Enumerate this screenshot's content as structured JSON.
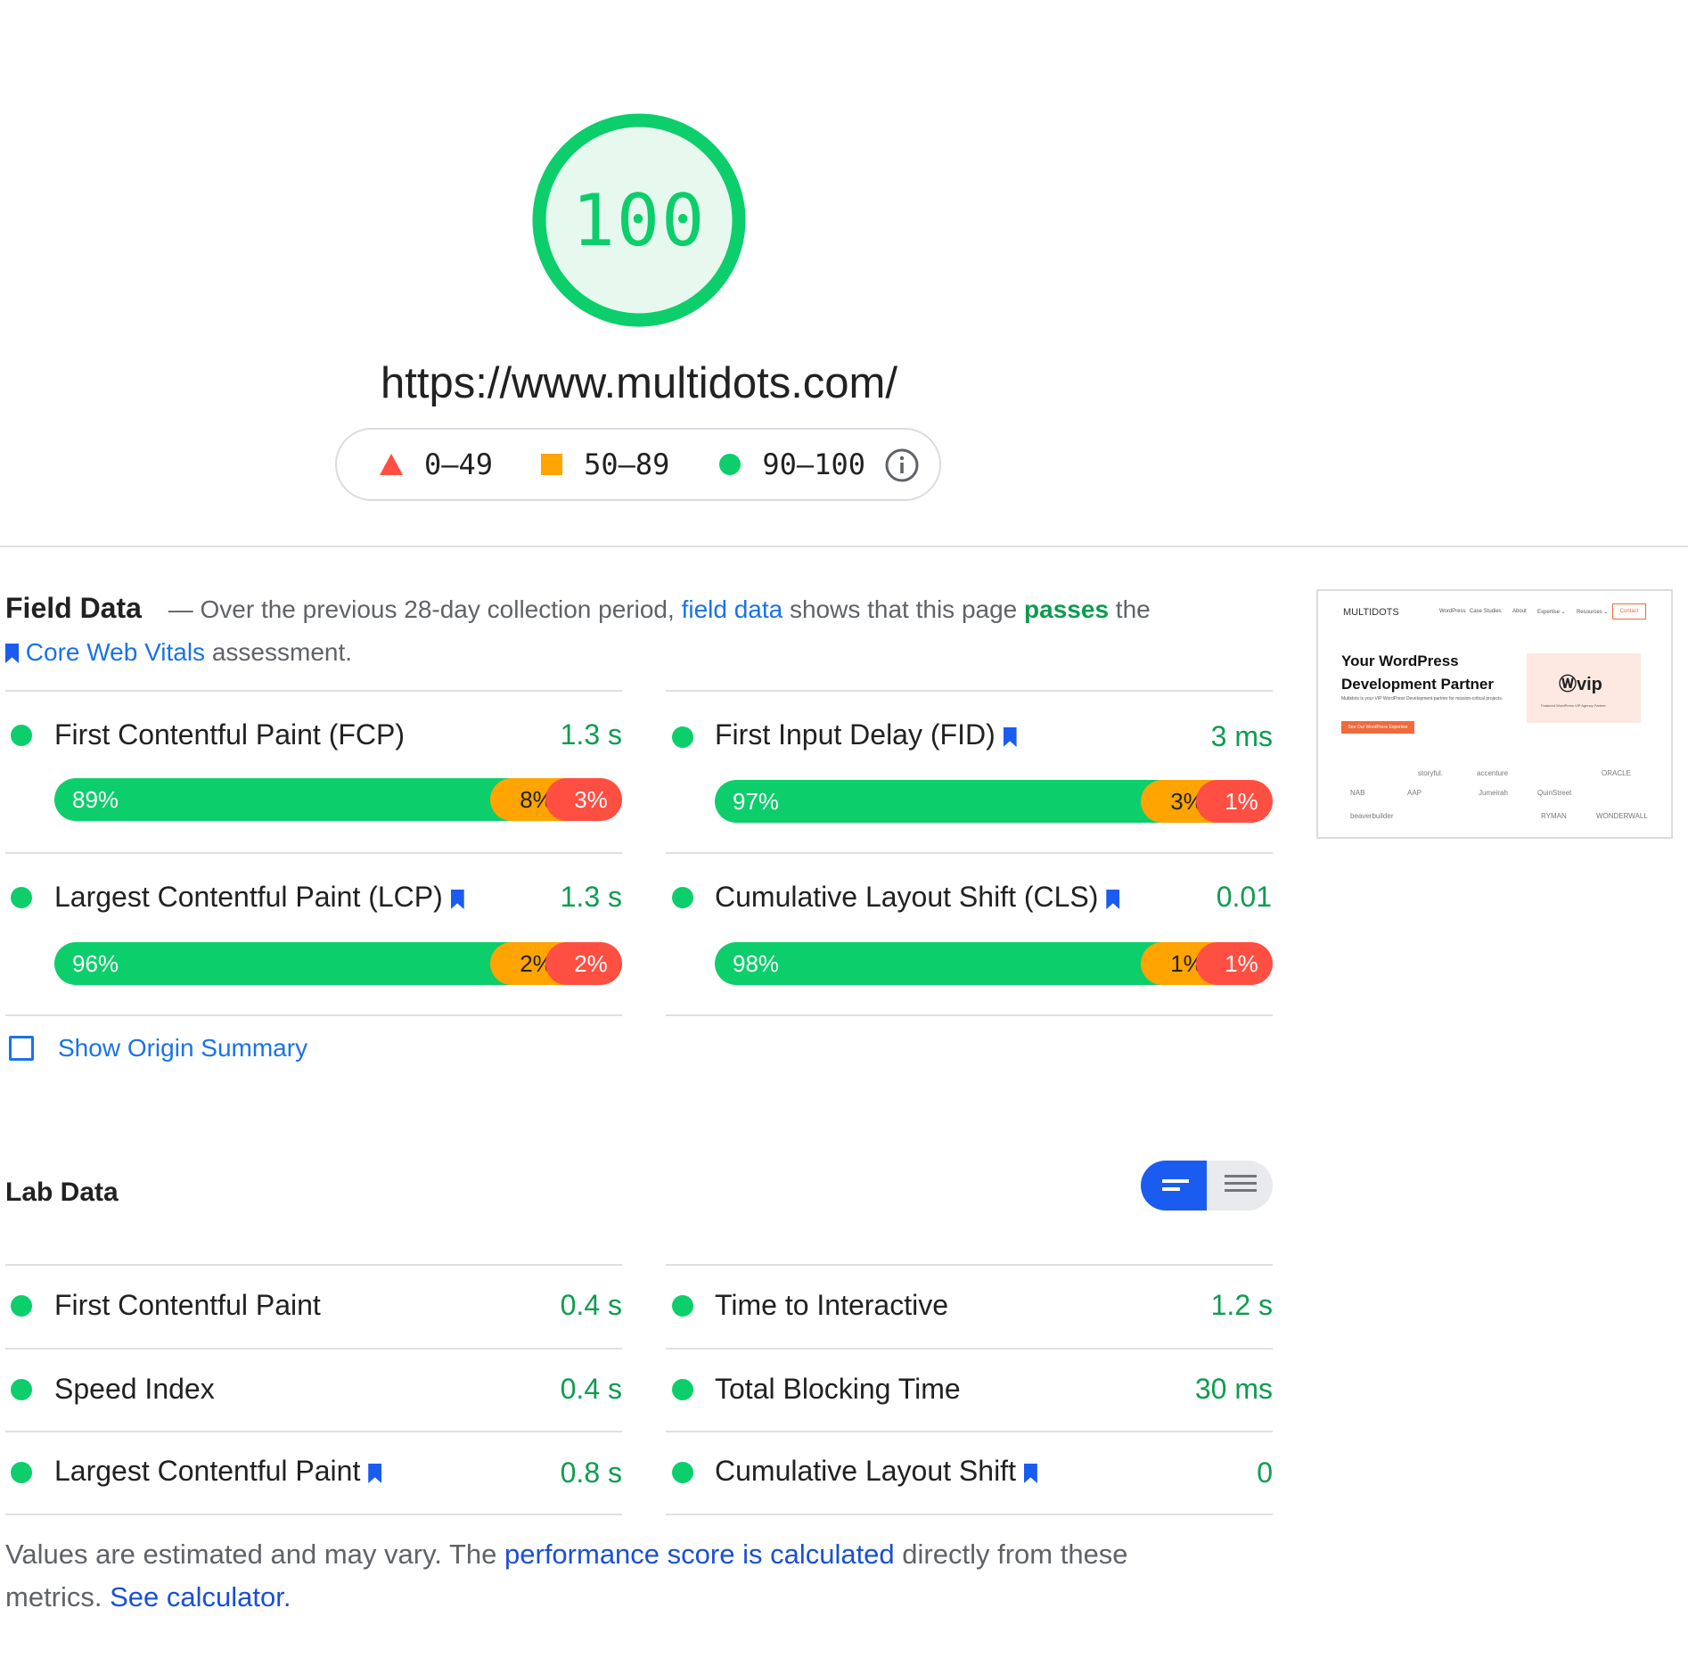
{
  "score": "100",
  "url": "https://www.multidots.com/",
  "legend": {
    "poor": "0–49",
    "average": "50–89",
    "good": "90–100"
  },
  "colors": {
    "good": "#0cce6b",
    "average": "#ffa400",
    "poor": "#ff4e42",
    "link": "#1a73e8",
    "pass_text": "#0d9c4f"
  },
  "field": {
    "title": "Field Data",
    "intro_1": "— Over the previous 28-day collection period,",
    "intro_link_1": "field data",
    "intro_2": "shows that this page",
    "intro_pass": "passes",
    "intro_3": "the",
    "intro_link_2": "Core Web Vitals",
    "intro_4": "assessment.",
    "metrics": [
      {
        "name": "First Contentful Paint (FCP)",
        "value": "1.3 s",
        "good": 89,
        "avg": 8,
        "poor": 3,
        "good_label": "89%",
        "avg_label": "8%",
        "poor_label": "3%"
      },
      {
        "name": "First Input Delay (FID)",
        "value": "3 ms",
        "good": 97,
        "avg": 3,
        "poor": 1,
        "good_label": "97%",
        "avg_label": "3%",
        "poor_label": "1%"
      },
      {
        "name": "Largest Contentful Paint (LCP)",
        "value": "1.3 s",
        "good": 96,
        "avg": 2,
        "poor": 2,
        "good_label": "96%",
        "avg_label": "2%",
        "poor_label": "2%"
      },
      {
        "name": "Cumulative Layout Shift (CLS)",
        "value": "0.01",
        "good": 98,
        "avg": 1,
        "poor": 1,
        "good_label": "98%",
        "avg_label": "1%",
        "poor_label": "1%"
      }
    ],
    "show_origin": "Show Origin Summary"
  },
  "thumbnail": {
    "logo": "MULTIDOTS",
    "nav": [
      "WordPress",
      "Case Studies",
      "About",
      "Expertise ⌄",
      "Resources ⌄"
    ],
    "contact": "Contact",
    "headline_1": "Your WordPress",
    "headline_2": "Development Partner",
    "sub": "Multidots is your VIP WordPress Development partner for mission-critical projects.",
    "cta": "See Our WordPress Expertise",
    "vip": "Ⓦvip",
    "vip_sub": "Featured WordPress VIP Agency Partner",
    "clients": [
      "storyful.",
      "accenture",
      "ORACLE",
      "NAB",
      "AAP",
      "Jumeirah",
      "QuinStreet",
      "beaverbuilder",
      "RYMAN",
      "WONDERWALL"
    ]
  },
  "lab": {
    "title": "Lab Data",
    "metrics": [
      {
        "name": "First Contentful Paint",
        "value": "0.4 s"
      },
      {
        "name": "Time to Interactive",
        "value": "1.2 s"
      },
      {
        "name": "Speed Index",
        "value": "0.4 s"
      },
      {
        "name": "Total Blocking Time",
        "value": "30 ms"
      },
      {
        "name": "Largest Contentful Paint",
        "value": "0.8 s"
      },
      {
        "name": "Cumulative Layout Shift",
        "value": "0"
      }
    ]
  },
  "footnote": {
    "text_1": "Values are estimated and may vary. The",
    "link_1": "performance score is calculated",
    "text_2": "directly from these metrics.",
    "link_2": "See calculator."
  }
}
